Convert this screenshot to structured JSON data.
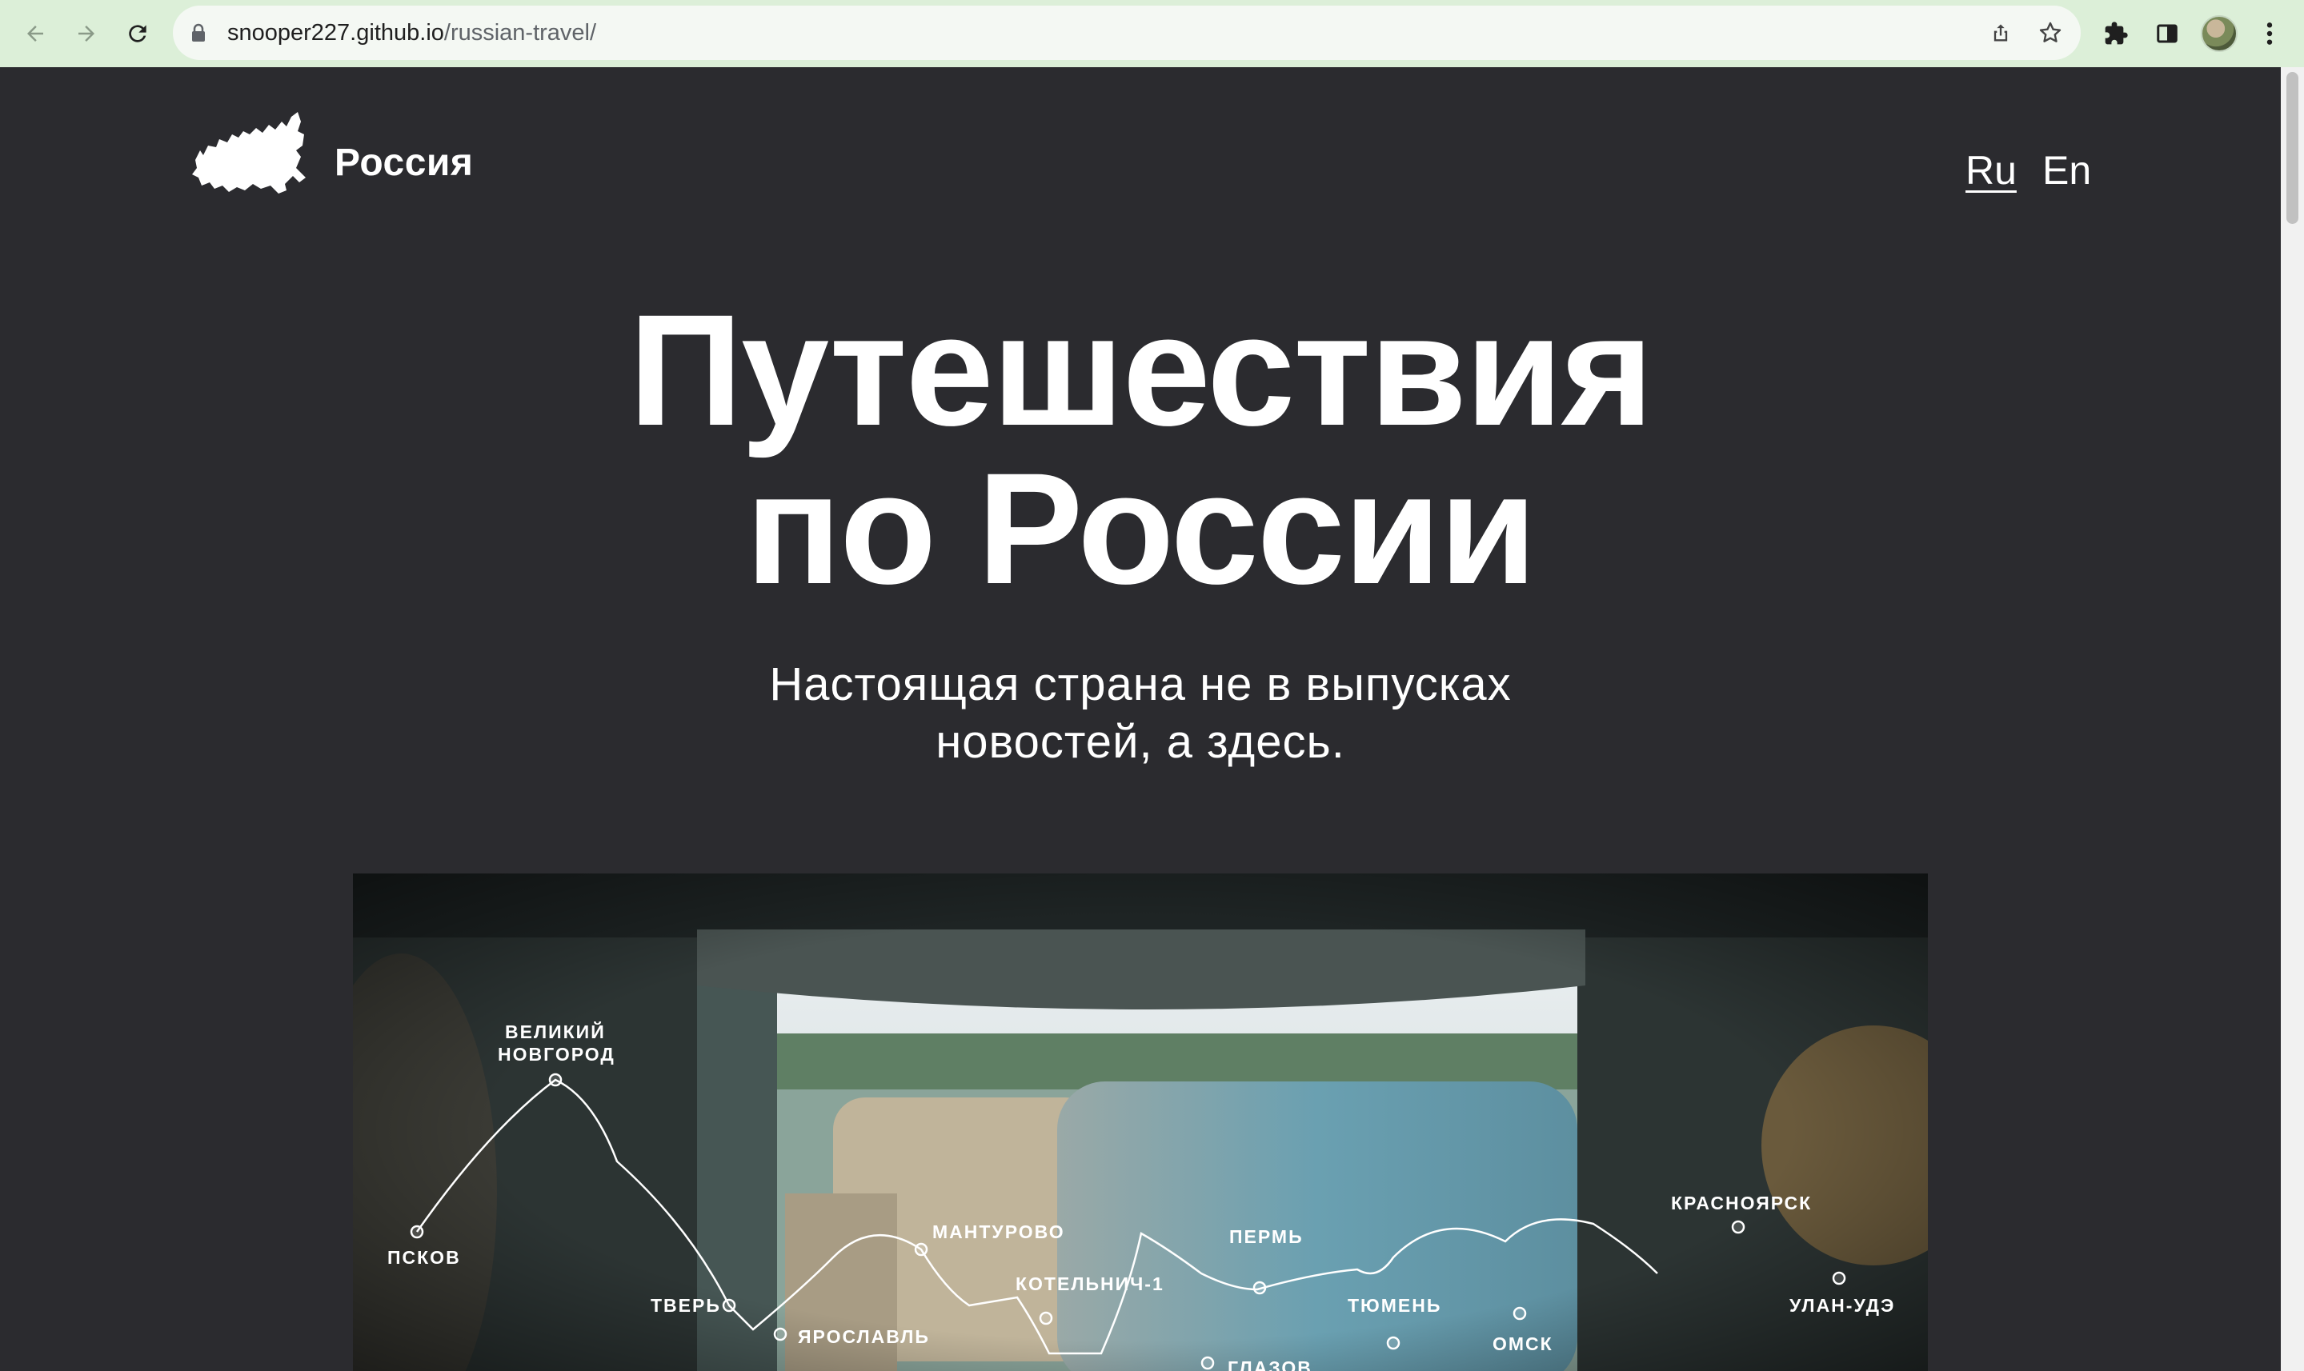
{
  "browser": {
    "url_host": "snooper227.github.io",
    "url_path": "/russian-travel/",
    "icons": [
      "back-icon",
      "forward-icon",
      "reload-icon",
      "lock-icon",
      "share-icon",
      "star-icon",
      "extensions-icon",
      "sidepanel-icon",
      "avatar",
      "menu-icon"
    ]
  },
  "header": {
    "brand": "Россия",
    "languages": [
      {
        "label": "Ru",
        "active": true
      },
      {
        "label": "En",
        "active": false
      }
    ]
  },
  "hero": {
    "title_line1": "Путешествия",
    "title_line2": "по России",
    "subtitle_line1": "Настоящая страна не в выпусках",
    "subtitle_line2": "новостей, а здесь."
  },
  "route": {
    "stops": [
      "ВЕЛИКИЙ",
      "НОВГОРОД",
      "ПСКОВ",
      "ТВЕРЬ",
      "ЯРОСЛАВЛЬ",
      "МАНТУРОВО",
      "КОТЕЛЬНИЧ-1",
      "ПЕРМЬ",
      "ГЛАЗОВ",
      "ТЮМЕНЬ",
      "ОМСК",
      "КРАСНОЯРСК",
      "УЛАН-УДЭ"
    ]
  }
}
